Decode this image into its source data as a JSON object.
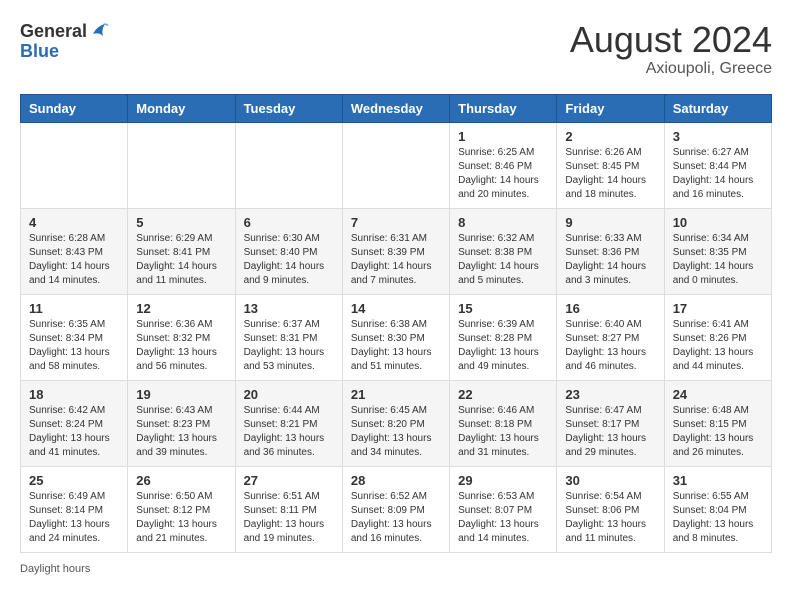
{
  "header": {
    "logo_general": "General",
    "logo_blue": "Blue",
    "month_year": "August 2024",
    "location": "Axioupoli, Greece"
  },
  "days_of_week": [
    "Sunday",
    "Monday",
    "Tuesday",
    "Wednesday",
    "Thursday",
    "Friday",
    "Saturday"
  ],
  "footer": {
    "daylight_label": "Daylight hours"
  },
  "weeks": [
    [
      {
        "day": "",
        "info": ""
      },
      {
        "day": "",
        "info": ""
      },
      {
        "day": "",
        "info": ""
      },
      {
        "day": "",
        "info": ""
      },
      {
        "day": "1",
        "info": "Sunrise: 6:25 AM\nSunset: 8:46 PM\nDaylight: 14 hours\nand 20 minutes."
      },
      {
        "day": "2",
        "info": "Sunrise: 6:26 AM\nSunset: 8:45 PM\nDaylight: 14 hours\nand 18 minutes."
      },
      {
        "day": "3",
        "info": "Sunrise: 6:27 AM\nSunset: 8:44 PM\nDaylight: 14 hours\nand 16 minutes."
      }
    ],
    [
      {
        "day": "4",
        "info": "Sunrise: 6:28 AM\nSunset: 8:43 PM\nDaylight: 14 hours\nand 14 minutes."
      },
      {
        "day": "5",
        "info": "Sunrise: 6:29 AM\nSunset: 8:41 PM\nDaylight: 14 hours\nand 11 minutes."
      },
      {
        "day": "6",
        "info": "Sunrise: 6:30 AM\nSunset: 8:40 PM\nDaylight: 14 hours\nand 9 minutes."
      },
      {
        "day": "7",
        "info": "Sunrise: 6:31 AM\nSunset: 8:39 PM\nDaylight: 14 hours\nand 7 minutes."
      },
      {
        "day": "8",
        "info": "Sunrise: 6:32 AM\nSunset: 8:38 PM\nDaylight: 14 hours\nand 5 minutes."
      },
      {
        "day": "9",
        "info": "Sunrise: 6:33 AM\nSunset: 8:36 PM\nDaylight: 14 hours\nand 3 minutes."
      },
      {
        "day": "10",
        "info": "Sunrise: 6:34 AM\nSunset: 8:35 PM\nDaylight: 14 hours\nand 0 minutes."
      }
    ],
    [
      {
        "day": "11",
        "info": "Sunrise: 6:35 AM\nSunset: 8:34 PM\nDaylight: 13 hours\nand 58 minutes."
      },
      {
        "day": "12",
        "info": "Sunrise: 6:36 AM\nSunset: 8:32 PM\nDaylight: 13 hours\nand 56 minutes."
      },
      {
        "day": "13",
        "info": "Sunrise: 6:37 AM\nSunset: 8:31 PM\nDaylight: 13 hours\nand 53 minutes."
      },
      {
        "day": "14",
        "info": "Sunrise: 6:38 AM\nSunset: 8:30 PM\nDaylight: 13 hours\nand 51 minutes."
      },
      {
        "day": "15",
        "info": "Sunrise: 6:39 AM\nSunset: 8:28 PM\nDaylight: 13 hours\nand 49 minutes."
      },
      {
        "day": "16",
        "info": "Sunrise: 6:40 AM\nSunset: 8:27 PM\nDaylight: 13 hours\nand 46 minutes."
      },
      {
        "day": "17",
        "info": "Sunrise: 6:41 AM\nSunset: 8:26 PM\nDaylight: 13 hours\nand 44 minutes."
      }
    ],
    [
      {
        "day": "18",
        "info": "Sunrise: 6:42 AM\nSunset: 8:24 PM\nDaylight: 13 hours\nand 41 minutes."
      },
      {
        "day": "19",
        "info": "Sunrise: 6:43 AM\nSunset: 8:23 PM\nDaylight: 13 hours\nand 39 minutes."
      },
      {
        "day": "20",
        "info": "Sunrise: 6:44 AM\nSunset: 8:21 PM\nDaylight: 13 hours\nand 36 minutes."
      },
      {
        "day": "21",
        "info": "Sunrise: 6:45 AM\nSunset: 8:20 PM\nDaylight: 13 hours\nand 34 minutes."
      },
      {
        "day": "22",
        "info": "Sunrise: 6:46 AM\nSunset: 8:18 PM\nDaylight: 13 hours\nand 31 minutes."
      },
      {
        "day": "23",
        "info": "Sunrise: 6:47 AM\nSunset: 8:17 PM\nDaylight: 13 hours\nand 29 minutes."
      },
      {
        "day": "24",
        "info": "Sunrise: 6:48 AM\nSunset: 8:15 PM\nDaylight: 13 hours\nand 26 minutes."
      }
    ],
    [
      {
        "day": "25",
        "info": "Sunrise: 6:49 AM\nSunset: 8:14 PM\nDaylight: 13 hours\nand 24 minutes."
      },
      {
        "day": "26",
        "info": "Sunrise: 6:50 AM\nSunset: 8:12 PM\nDaylight: 13 hours\nand 21 minutes."
      },
      {
        "day": "27",
        "info": "Sunrise: 6:51 AM\nSunset: 8:11 PM\nDaylight: 13 hours\nand 19 minutes."
      },
      {
        "day": "28",
        "info": "Sunrise: 6:52 AM\nSunset: 8:09 PM\nDaylight: 13 hours\nand 16 minutes."
      },
      {
        "day": "29",
        "info": "Sunrise: 6:53 AM\nSunset: 8:07 PM\nDaylight: 13 hours\nand 14 minutes."
      },
      {
        "day": "30",
        "info": "Sunrise: 6:54 AM\nSunset: 8:06 PM\nDaylight: 13 hours\nand 11 minutes."
      },
      {
        "day": "31",
        "info": "Sunrise: 6:55 AM\nSunset: 8:04 PM\nDaylight: 13 hours\nand 8 minutes."
      }
    ]
  ]
}
